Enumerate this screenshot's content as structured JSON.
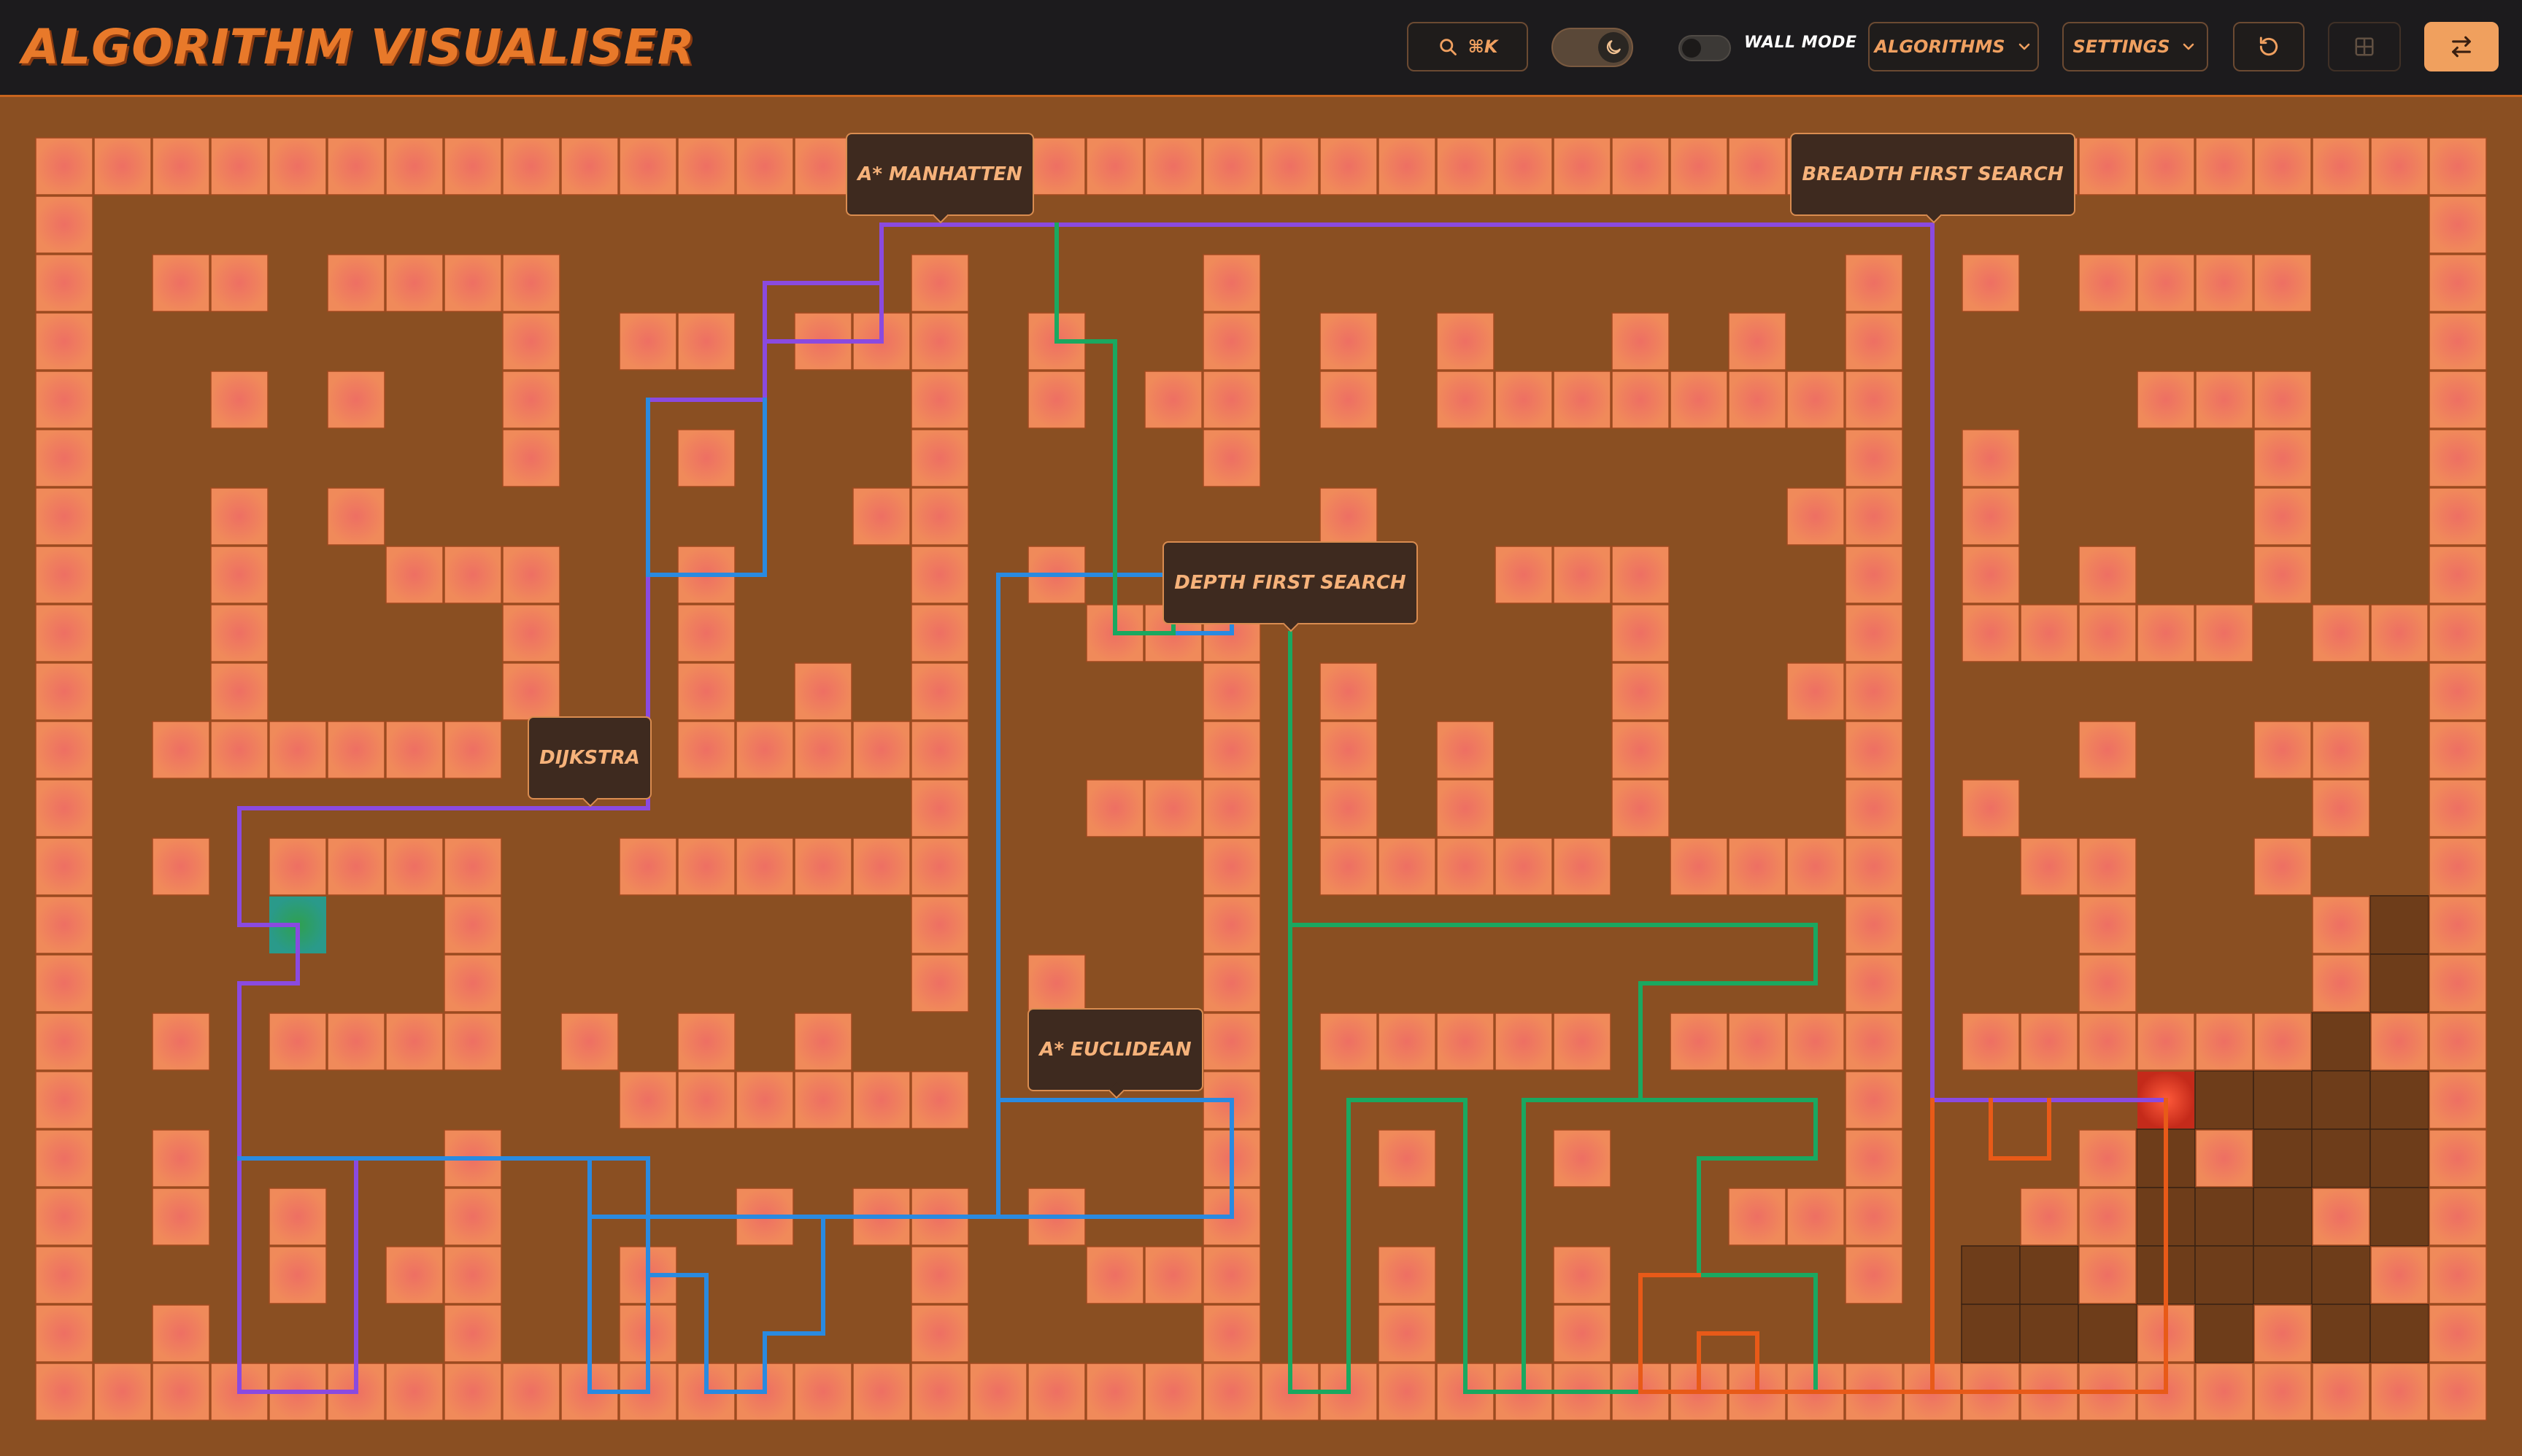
{
  "app": {
    "title": "ALGORITHM VISUALISER"
  },
  "toolbar": {
    "search_shortcut": "⌘K",
    "theme_toggle_state": "dark",
    "wall_mode_label": "WALL MODE",
    "wall_mode_on": false,
    "algorithms_label": "ALGORITHMS",
    "settings_label": "SETTINGS",
    "reset_icon": "rotate-ccw-icon",
    "grid_icon": "grid-icon",
    "swap_icon": "swap-arrows-icon"
  },
  "colors": {
    "topbar": "#1c1b1d",
    "board_background": "#8a4f22",
    "wall_tile": "#f08a5a",
    "wall_tile_center": "#ee6f63",
    "accent": "#e8792a",
    "start_node": "#2a9a8a",
    "end_node": "#e24a2a",
    "tooltip_bg": "#3e2a1f"
  },
  "algorithm_labels": {
    "astar_manhattan": "A* MANHATTEN",
    "bfs": "BREADTH FIRST SEARCH",
    "dfs": "DEPTH FIRST SEARCH",
    "dijkstra": "DIJKSTRA",
    "astar_euclidean": "A* EUCLIDEAN"
  },
  "grid": {
    "cols": 42,
    "rows": 22,
    "start": [
      4,
      13
    ],
    "end": [
      36,
      16
    ],
    "walls": [
      [
        2,
        2
      ],
      [
        3,
        2
      ],
      [
        5,
        2
      ],
      [
        6,
        2
      ],
      [
        7,
        2
      ],
      [
        8,
        2
      ],
      [
        15,
        2
      ],
      [
        20,
        2
      ],
      [
        31,
        2
      ],
      [
        33,
        2
      ],
      [
        35,
        2
      ],
      [
        36,
        2
      ],
      [
        37,
        2
      ],
      [
        38,
        2
      ],
      [
        8,
        3
      ],
      [
        10,
        3
      ],
      [
        11,
        3
      ],
      [
        13,
        3
      ],
      [
        14,
        3
      ],
      [
        15,
        3
      ],
      [
        17,
        3
      ],
      [
        20,
        3
      ],
      [
        22,
        3
      ],
      [
        24,
        3
      ],
      [
        27,
        3
      ],
      [
        29,
        3
      ],
      [
        31,
        3
      ],
      [
        3,
        4
      ],
      [
        5,
        4
      ],
      [
        8,
        4
      ],
      [
        15,
        4
      ],
      [
        17,
        4
      ],
      [
        19,
        4
      ],
      [
        20,
        4
      ],
      [
        22,
        4
      ],
      [
        24,
        4
      ],
      [
        25,
        4
      ],
      [
        26,
        4
      ],
      [
        27,
        4
      ],
      [
        28,
        4
      ],
      [
        29,
        4
      ],
      [
        30,
        4
      ],
      [
        31,
        4
      ],
      [
        36,
        4
      ],
      [
        37,
        4
      ],
      [
        38,
        4
      ],
      [
        8,
        5
      ],
      [
        11,
        5
      ],
      [
        15,
        5
      ],
      [
        20,
        5
      ],
      [
        31,
        5
      ],
      [
        33,
        5
      ],
      [
        38,
        5
      ],
      [
        3,
        6
      ],
      [
        5,
        6
      ],
      [
        14,
        6
      ],
      [
        15,
        6
      ],
      [
        22,
        6
      ],
      [
        30,
        6
      ],
      [
        31,
        6
      ],
      [
        33,
        6
      ],
      [
        38,
        6
      ],
      [
        3,
        7
      ],
      [
        6,
        7
      ],
      [
        7,
        7
      ],
      [
        8,
        7
      ],
      [
        11,
        7
      ],
      [
        15,
        7
      ],
      [
        17,
        7
      ],
      [
        25,
        7
      ],
      [
        26,
        7
      ],
      [
        27,
        7
      ],
      [
        31,
        7
      ],
      [
        33,
        7
      ],
      [
        35,
        7
      ],
      [
        38,
        7
      ],
      [
        3,
        8
      ],
      [
        8,
        8
      ],
      [
        11,
        8
      ],
      [
        15,
        8
      ],
      [
        18,
        8
      ],
      [
        19,
        8
      ],
      [
        20,
        8
      ],
      [
        27,
        8
      ],
      [
        31,
        8
      ],
      [
        33,
        8
      ],
      [
        34,
        8
      ],
      [
        35,
        8
      ],
      [
        36,
        8
      ],
      [
        37,
        8
      ],
      [
        39,
        8
      ],
      [
        40,
        8
      ],
      [
        3,
        9
      ],
      [
        8,
        9
      ],
      [
        11,
        9
      ],
      [
        13,
        9
      ],
      [
        15,
        9
      ],
      [
        20,
        9
      ],
      [
        22,
        9
      ],
      [
        27,
        9
      ],
      [
        30,
        9
      ],
      [
        31,
        9
      ],
      [
        2,
        10
      ],
      [
        3,
        10
      ],
      [
        4,
        10
      ],
      [
        5,
        10
      ],
      [
        6,
        10
      ],
      [
        7,
        10
      ],
      [
        11,
        10
      ],
      [
        12,
        10
      ],
      [
        13,
        10
      ],
      [
        14,
        10
      ],
      [
        15,
        10
      ],
      [
        20,
        10
      ],
      [
        22,
        10
      ],
      [
        24,
        10
      ],
      [
        27,
        10
      ],
      [
        31,
        10
      ],
      [
        35,
        10
      ],
      [
        38,
        10
      ],
      [
        39,
        10
      ],
      [
        15,
        11
      ],
      [
        18,
        11
      ],
      [
        19,
        11
      ],
      [
        20,
        11
      ],
      [
        22,
        11
      ],
      [
        24,
        11
      ],
      [
        27,
        11
      ],
      [
        31,
        11
      ],
      [
        33,
        11
      ],
      [
        39,
        11
      ],
      [
        2,
        12
      ],
      [
        4,
        12
      ],
      [
        5,
        12
      ],
      [
        6,
        12
      ],
      [
        7,
        12
      ],
      [
        10,
        12
      ],
      [
        11,
        12
      ],
      [
        12,
        12
      ],
      [
        13,
        12
      ],
      [
        14,
        12
      ],
      [
        15,
        12
      ],
      [
        20,
        12
      ],
      [
        22,
        12
      ],
      [
        23,
        12
      ],
      [
        24,
        12
      ],
      [
        25,
        12
      ],
      [
        26,
        12
      ],
      [
        28,
        12
      ],
      [
        29,
        12
      ],
      [
        30,
        12
      ],
      [
        31,
        12
      ],
      [
        34,
        12
      ],
      [
        35,
        12
      ],
      [
        38,
        12
      ],
      [
        7,
        13
      ],
      [
        15,
        13
      ],
      [
        20,
        13
      ],
      [
        31,
        13
      ],
      [
        35,
        13
      ],
      [
        39,
        13
      ],
      [
        7,
        14
      ],
      [
        15,
        14
      ],
      [
        17,
        14
      ],
      [
        20,
        14
      ],
      [
        31,
        14
      ],
      [
        35,
        14
      ],
      [
        39,
        14
      ],
      [
        2,
        15
      ],
      [
        4,
        15
      ],
      [
        5,
        15
      ],
      [
        6,
        15
      ],
      [
        7,
        15
      ],
      [
        9,
        15
      ],
      [
        11,
        15
      ],
      [
        13,
        15
      ],
      [
        17,
        15
      ],
      [
        20,
        15
      ],
      [
        22,
        15
      ],
      [
        23,
        15
      ],
      [
        24,
        15
      ],
      [
        25,
        15
      ],
      [
        26,
        15
      ],
      [
        28,
        15
      ],
      [
        29,
        15
      ],
      [
        30,
        15
      ],
      [
        31,
        15
      ],
      [
        33,
        15
      ],
      [
        34,
        15
      ],
      [
        35,
        15
      ],
      [
        36,
        15
      ],
      [
        37,
        15
      ],
      [
        38,
        15
      ],
      [
        40,
        15
      ],
      [
        10,
        16
      ],
      [
        11,
        16
      ],
      [
        12,
        16
      ],
      [
        13,
        16
      ],
      [
        14,
        16
      ],
      [
        15,
        16
      ],
      [
        20,
        16
      ],
      [
        31,
        16
      ],
      [
        2,
        17
      ],
      [
        7,
        17
      ],
      [
        20,
        17
      ],
      [
        23,
        17
      ],
      [
        26,
        17
      ],
      [
        31,
        17
      ],
      [
        35,
        17
      ],
      [
        37,
        17
      ],
      [
        2,
        18
      ],
      [
        4,
        18
      ],
      [
        7,
        18
      ],
      [
        12,
        18
      ],
      [
        14,
        18
      ],
      [
        15,
        18
      ],
      [
        17,
        18
      ],
      [
        20,
        18
      ],
      [
        29,
        18
      ],
      [
        30,
        18
      ],
      [
        31,
        18
      ],
      [
        34,
        18
      ],
      [
        35,
        18
      ],
      [
        39,
        18
      ],
      [
        4,
        19
      ],
      [
        6,
        19
      ],
      [
        7,
        19
      ],
      [
        10,
        19
      ],
      [
        15,
        19
      ],
      [
        18,
        19
      ],
      [
        19,
        19
      ],
      [
        20,
        19
      ],
      [
        23,
        19
      ],
      [
        26,
        19
      ],
      [
        31,
        19
      ],
      [
        35,
        19
      ],
      [
        40,
        19
      ],
      [
        2,
        20
      ],
      [
        7,
        20
      ],
      [
        10,
        20
      ],
      [
        15,
        20
      ],
      [
        20,
        20
      ],
      [
        23,
        20
      ],
      [
        26,
        20
      ],
      [
        36,
        20
      ],
      [
        38,
        20
      ]
    ],
    "dark_cells": [
      [
        40,
        13
      ],
      [
        40,
        14
      ],
      [
        39,
        15
      ],
      [
        37,
        16
      ],
      [
        38,
        16
      ],
      [
        39,
        16
      ],
      [
        40,
        16
      ],
      [
        36,
        17
      ],
      [
        38,
        17
      ],
      [
        39,
        17
      ],
      [
        40,
        17
      ],
      [
        36,
        18
      ],
      [
        37,
        18
      ],
      [
        38,
        18
      ],
      [
        40,
        18
      ],
      [
        33,
        19
      ],
      [
        34,
        19
      ],
      [
        36,
        19
      ],
      [
        37,
        19
      ],
      [
        38,
        19
      ],
      [
        39,
        19
      ],
      [
        33,
        20
      ],
      [
        34,
        20
      ],
      [
        35,
        20
      ],
      [
        37,
        20
      ],
      [
        39,
        20
      ],
      [
        40,
        20
      ]
    ]
  },
  "paths": [
    {
      "name": "Dijkstra",
      "color": "#8a4ae0",
      "points": [
        [
          4,
          13
        ],
        [
          3,
          13
        ],
        [
          3,
          11
        ],
        [
          10,
          11
        ],
        [
          10,
          4
        ],
        [
          12,
          4
        ],
        [
          12,
          2
        ],
        [
          14,
          2
        ],
        [
          14,
          1
        ],
        [
          32,
          1
        ],
        [
          32,
          16
        ],
        [
          36,
          16
        ]
      ],
      "extra": [
        [
          [
            4,
            13
          ],
          [
            4,
            14
          ],
          [
            3,
            14
          ],
          [
            3,
            21
          ],
          [
            5,
            21
          ],
          [
            5,
            17
          ],
          [
            3,
            17
          ]
        ],
        [
          [
            12,
            2
          ],
          [
            12,
            3
          ],
          [
            14,
            3
          ],
          [
            14,
            2
          ]
        ]
      ]
    },
    {
      "name": "A* Euclidean",
      "color": "#2a8ae0",
      "points": [
        [
          3,
          17
        ],
        [
          9,
          17
        ],
        [
          9,
          18
        ],
        [
          16,
          18
        ],
        [
          16,
          7
        ],
        [
          19,
          7
        ],
        [
          19,
          8
        ],
        [
          20,
          8
        ],
        [
          20,
          7
        ],
        [
          21,
          7
        ]
      ],
      "extra": [
        [
          [
            9,
            17
          ],
          [
            9,
            21
          ],
          [
            10,
            21
          ],
          [
            10,
            17
          ],
          [
            9,
            17
          ]
        ],
        [
          [
            10,
            18
          ],
          [
            10,
            19
          ],
          [
            11,
            19
          ],
          [
            11,
            21
          ],
          [
            12,
            21
          ],
          [
            12,
            20
          ],
          [
            13,
            20
          ],
          [
            13,
            18
          ]
        ],
        [
          [
            16,
            16
          ],
          [
            20,
            16
          ],
          [
            20,
            18
          ],
          [
            16,
            18
          ]
        ],
        [
          [
            10,
            4
          ],
          [
            10,
            7
          ],
          [
            12,
            7
          ],
          [
            12,
            4
          ]
        ]
      ]
    },
    {
      "name": "DFS",
      "color": "#1aa860",
      "points": [
        [
          17,
          1
        ],
        [
          17,
          3
        ],
        [
          18,
          3
        ],
        [
          18,
          8
        ],
        [
          19,
          8
        ],
        [
          19,
          7
        ]
      ],
      "extra": [
        [
          [
            21,
            8
          ],
          [
            21,
            13
          ],
          [
            30,
            13
          ],
          [
            30,
            14
          ],
          [
            27,
            14
          ],
          [
            27,
            16
          ],
          [
            30,
            16
          ],
          [
            30,
            17
          ],
          [
            28,
            17
          ],
          [
            28,
            19
          ],
          [
            30,
            19
          ],
          [
            30,
            21
          ],
          [
            25,
            21
          ],
          [
            25,
            16
          ],
          [
            27,
            16
          ]
        ],
        [
          [
            21,
            13
          ],
          [
            21,
            21
          ],
          [
            22,
            21
          ],
          [
            22,
            16
          ],
          [
            24,
            16
          ],
          [
            24,
            21
          ],
          [
            25,
            21
          ]
        ]
      ]
    },
    {
      "name": "BFS",
      "color": "#e85a18",
      "points": [
        [
          32,
          16
        ],
        [
          32,
          21
        ],
        [
          36,
          21
        ],
        [
          36,
          16
        ]
      ],
      "extra": [
        [
          [
            33,
            16
          ],
          [
            33,
            17
          ],
          [
            34,
            17
          ],
          [
            34,
            16
          ]
        ],
        [
          [
            32,
            21
          ],
          [
            28,
            21
          ],
          [
            28,
            20
          ],
          [
            29,
            20
          ],
          [
            29,
            21
          ]
        ],
        [
          [
            28,
            19
          ],
          [
            27,
            19
          ],
          [
            27,
            21
          ],
          [
            28,
            21
          ]
        ]
      ]
    }
  ],
  "tooltips": [
    {
      "key": "astar_manhattan",
      "col": 15,
      "row": 1
    },
    {
      "key": "bfs",
      "col": 32,
      "row": 1
    },
    {
      "key": "dfs",
      "col": 21,
      "row": 8
    },
    {
      "key": "dijkstra",
      "col": 9,
      "row": 11
    },
    {
      "key": "astar_euclidean",
      "col": 18,
      "row": 16
    }
  ]
}
